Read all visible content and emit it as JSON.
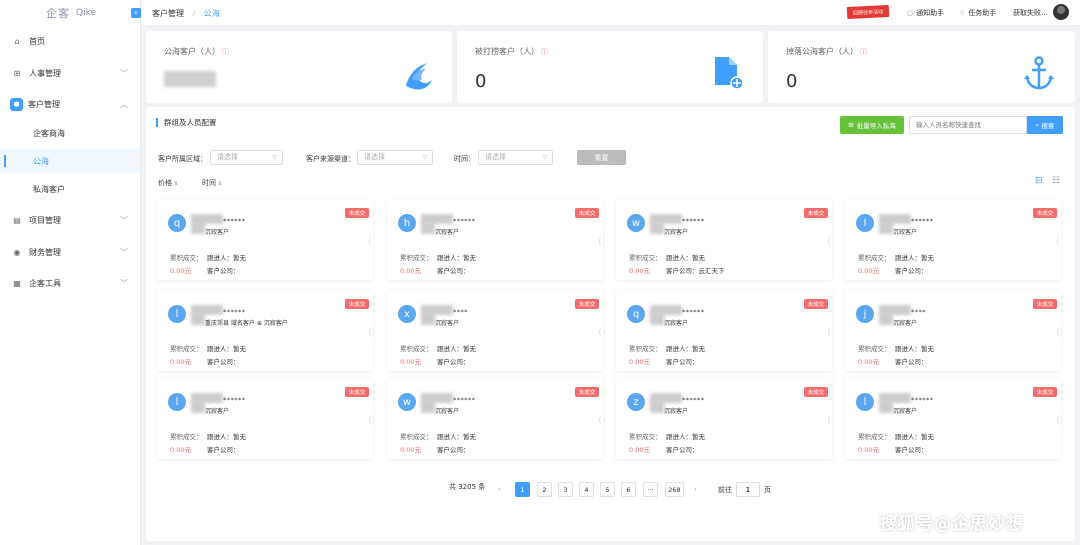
{
  "sidebar": {
    "logo": "企客",
    "logo_en": "Qike",
    "items": [
      {
        "label": "首页"
      },
      {
        "label": "人事管理"
      },
      {
        "label": "客户管理"
      },
      {
        "label": "项目管理"
      },
      {
        "label": "财务管理"
      },
      {
        "label": "企客工具"
      }
    ],
    "sub_items": [
      {
        "label": "企客商海"
      },
      {
        "label": "公海"
      },
      {
        "label": "私海客户"
      }
    ]
  },
  "header": {
    "breadcrumb_parent": "客户管理",
    "breadcrumb_current": "公海",
    "promo": "回顾往年活动",
    "notify": "通知助手",
    "tasks": "任务助手",
    "user": "获取失败..."
  },
  "stats": [
    {
      "title": "公海客户（人）",
      "value": ""
    },
    {
      "title": "被打捞客户（人）",
      "value": "0"
    },
    {
      "title": "掉落公海客户（人）",
      "value": "0"
    }
  ],
  "toolbar": {
    "section_title": "群组及人员配置",
    "import_label": "批量导入私海",
    "search_placeholder": "输入人员名称快速查找",
    "search_label": "搜索"
  },
  "filters": {
    "region_label": "客户所属区域：",
    "region_placeholder": "请选择",
    "channel_label": "客户来源渠道：",
    "channel_placeholder": "请选择",
    "time_label": "时间：",
    "time_placeholder": "请选择",
    "reset_label": "重置"
  },
  "sort": {
    "price": "价格",
    "time": "时间"
  },
  "card_labels": {
    "status": "未成交",
    "total": "累积成交：",
    "follower": "跟进人：",
    "company": "客户公司："
  },
  "cards": [
    {
      "initial": "q",
      "stars": "******",
      "tag": "沉寂客户",
      "follower_value": "暂无",
      "amount": "0.00元",
      "company_value": ""
    },
    {
      "initial": "h",
      "stars": "******",
      "tag": "沉寂客户",
      "follower_value": "暂无",
      "amount": "0.00元",
      "company_value": ""
    },
    {
      "initial": "w",
      "stars": "******",
      "tag": "沉寂客户",
      "follower_value": "暂无",
      "amount": "0.00元",
      "company_value": "云汇天下"
    },
    {
      "initial": "l",
      "stars": "******",
      "tag": "沉寂客户",
      "follower_value": "暂无",
      "amount": "0.00元",
      "company_value": ""
    },
    {
      "initial": "l",
      "stars": "******",
      "tag": "重庆郊县  域名客户  ⊕ 沉寂客户",
      "follower_value": "暂无",
      "amount": "0.00元",
      "company_value": ""
    },
    {
      "initial": "x",
      "stars": "****",
      "tag": "沉寂客户",
      "follower_value": "暂无",
      "amount": "0.00元",
      "company_value": ""
    },
    {
      "initial": "q",
      "stars": "******",
      "tag": "沉寂客户",
      "follower_value": "暂无",
      "amount": "0.00元",
      "company_value": ""
    },
    {
      "initial": "j",
      "stars": "****",
      "tag": "沉寂客户",
      "follower_value": "暂无",
      "amount": "0.00元",
      "company_value": ""
    },
    {
      "initial": "l",
      "stars": "******",
      "tag": "沉寂客户",
      "follower_value": "暂无",
      "amount": "0.00元",
      "company_value": ""
    },
    {
      "initial": "w",
      "stars": "******",
      "tag": "沉寂客户",
      "follower_value": "暂无",
      "amount": "0.00元",
      "company_value": ""
    },
    {
      "initial": "z",
      "stars": "******",
      "tag": "沉寂客户",
      "follower_value": "暂无",
      "amount": "0.00元",
      "company_value": ""
    },
    {
      "initial": "l",
      "stars": "******",
      "tag": "沉寂客户",
      "follower_value": "暂无",
      "amount": "0.00元",
      "company_value": ""
    }
  ],
  "pagination": {
    "total": "共 3205 条",
    "pages": [
      "1",
      "2",
      "3",
      "4",
      "5",
      "6",
      "···",
      "268"
    ],
    "goto_label": "前往",
    "goto_value": "1",
    "page_unit": "页"
  },
  "watermark": "搜狐号@企思妙想",
  "colors": {
    "primary": "#409eff",
    "success": "#67c23a",
    "danger": "#f56c6c"
  }
}
